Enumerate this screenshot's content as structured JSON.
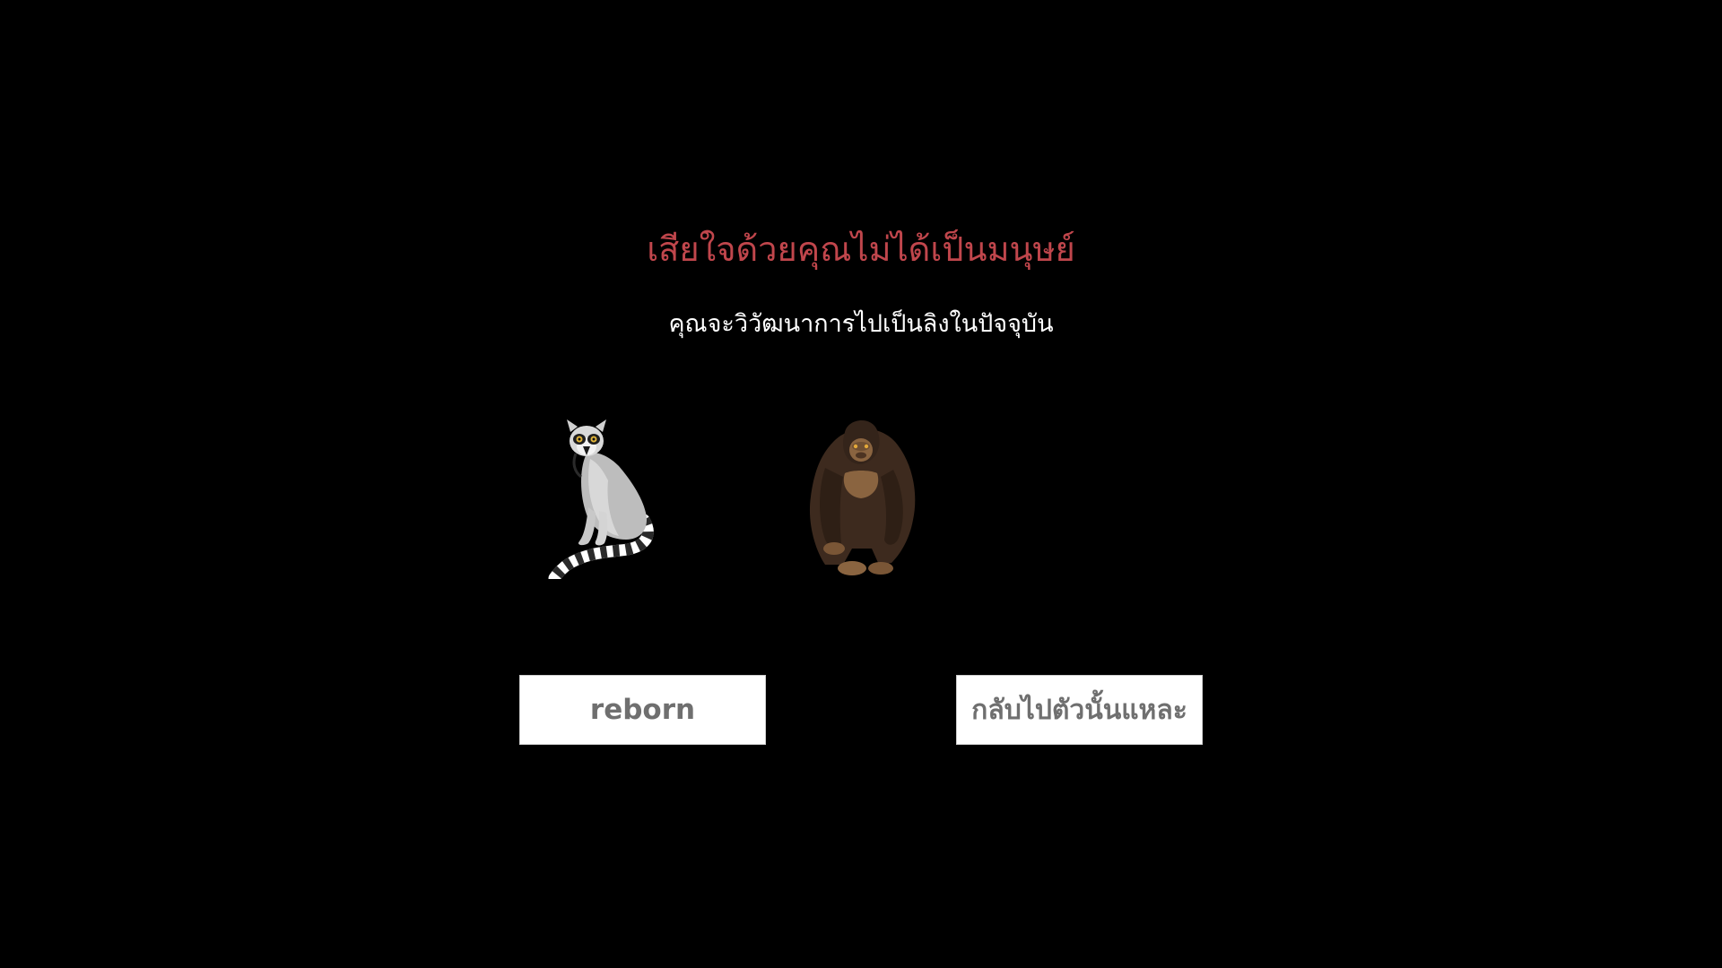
{
  "screen": {
    "title": "เสียใจด้วยคุณไม่ได้เป็นมนุษย์",
    "subtitle": "คุณจะวิวัฒนาการไปเป็นลิงในปัจจุบัน"
  },
  "animals": [
    {
      "icon": "lemur-icon"
    },
    {
      "icon": "gorilla-icon"
    }
  ],
  "buttons": {
    "reborn_label": "reborn",
    "back_label": "กลับไปตัวนั้นแหละ"
  },
  "colors": {
    "background": "#000000",
    "title": "#c0464c",
    "subtitle": "#ffffff",
    "button_bg": "#ffffff",
    "button_text": "#6f6f6f"
  }
}
